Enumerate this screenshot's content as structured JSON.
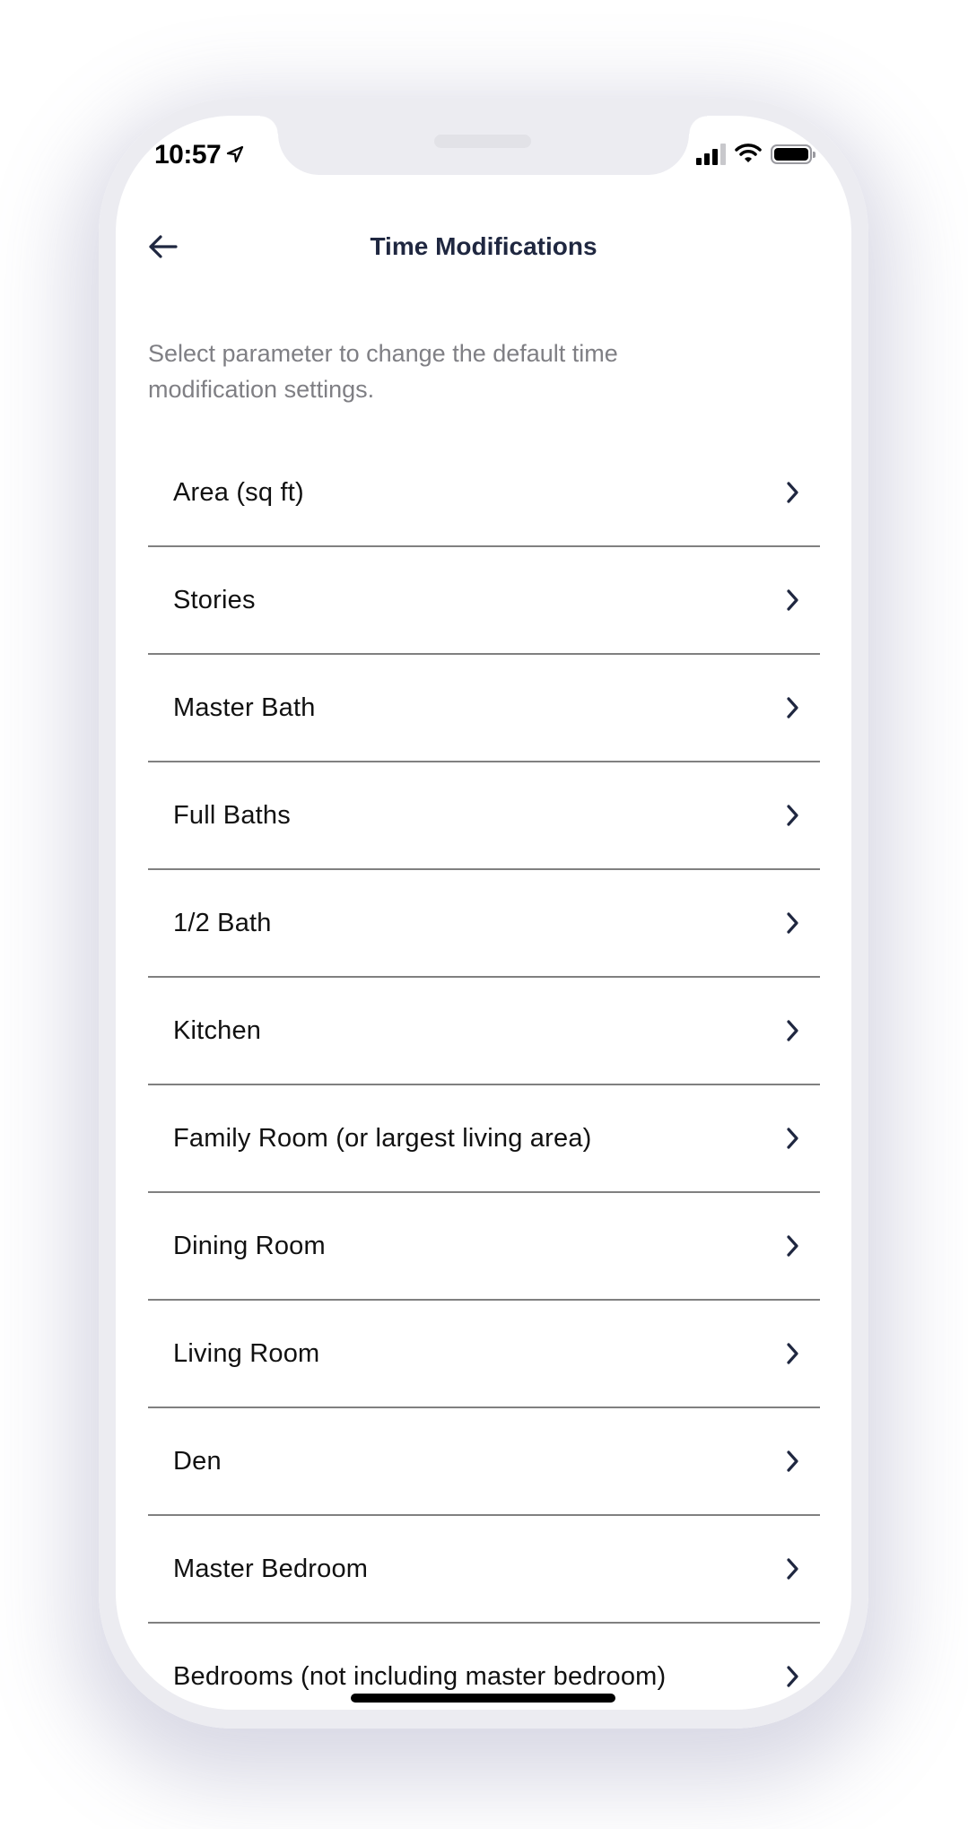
{
  "status_bar": {
    "time": "10:57",
    "icons": [
      "location-arrow-icon",
      "cellular-signal-icon",
      "wifi-icon",
      "battery-icon"
    ],
    "signal_bars_active": 3,
    "signal_bars_total": 4
  },
  "header": {
    "back_icon": "arrow-left-icon",
    "title": "Time Modifications"
  },
  "description": "Select parameter to change the default time modification settings.",
  "parameters": [
    {
      "label": "Area (sq ft)"
    },
    {
      "label": "Stories"
    },
    {
      "label": "Master Bath"
    },
    {
      "label": "Full Baths"
    },
    {
      "label": "1/2 Bath"
    },
    {
      "label": "Kitchen"
    },
    {
      "label": "Family Room (or largest living area)"
    },
    {
      "label": "Dining Room"
    },
    {
      "label": "Living Room"
    },
    {
      "label": "Den"
    },
    {
      "label": "Master Bedroom"
    },
    {
      "label": "Bedrooms (not including master bedroom)"
    }
  ],
  "colors": {
    "title": "#1f2740",
    "description": "#7f7f84",
    "divider": "#808080",
    "chevron": "#1f2740",
    "frame": "#ececf1"
  }
}
